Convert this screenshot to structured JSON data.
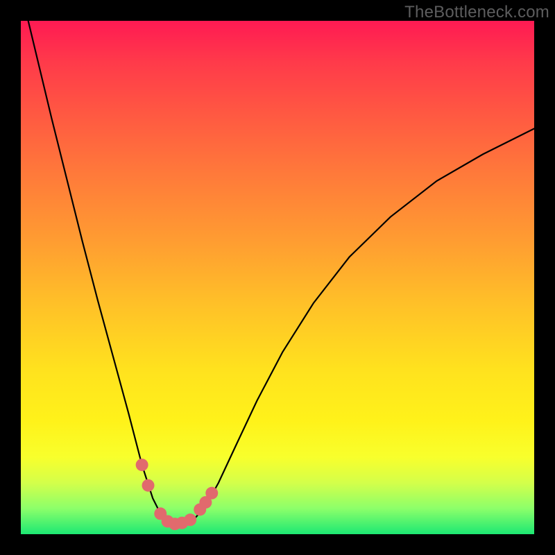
{
  "watermark": "TheBottleneck.com",
  "chart_data": {
    "type": "line",
    "title": "",
    "xlabel": "",
    "ylabel": "",
    "xlim": [
      0,
      1
    ],
    "ylim": [
      0,
      1
    ],
    "series": [
      {
        "name": "bottleneck-curve",
        "x": [
          0.0,
          0.03,
          0.06,
          0.09,
          0.12,
          0.15,
          0.18,
          0.21,
          0.236,
          0.257,
          0.272,
          0.286,
          0.3,
          0.32,
          0.34,
          0.36,
          0.385,
          0.42,
          0.46,
          0.51,
          0.57,
          0.64,
          0.72,
          0.81,
          0.9,
          1.0
        ],
        "y": [
          1.06,
          0.935,
          0.81,
          0.69,
          0.57,
          0.455,
          0.345,
          0.235,
          0.135,
          0.07,
          0.04,
          0.025,
          0.02,
          0.022,
          0.032,
          0.055,
          0.1,
          0.175,
          0.26,
          0.355,
          0.45,
          0.54,
          0.618,
          0.688,
          0.74,
          0.79
        ]
      }
    ],
    "markers": {
      "name": "highlight-points",
      "color": "#e16a6d",
      "x": [
        0.236,
        0.248,
        0.272,
        0.286,
        0.3,
        0.314,
        0.33,
        0.349,
        0.36,
        0.372
      ],
      "y": [
        0.135,
        0.095,
        0.04,
        0.025,
        0.02,
        0.022,
        0.028,
        0.048,
        0.062,
        0.08
      ]
    },
    "gradient_stops": [
      {
        "pos": 0.0,
        "color": "#ff1a53"
      },
      {
        "pos": 0.3,
        "color": "#ff7a3a"
      },
      {
        "pos": 0.68,
        "color": "#ffe21e"
      },
      {
        "pos": 0.9,
        "color": "#d4ff4a"
      },
      {
        "pos": 1.0,
        "color": "#1ce873"
      }
    ]
  }
}
